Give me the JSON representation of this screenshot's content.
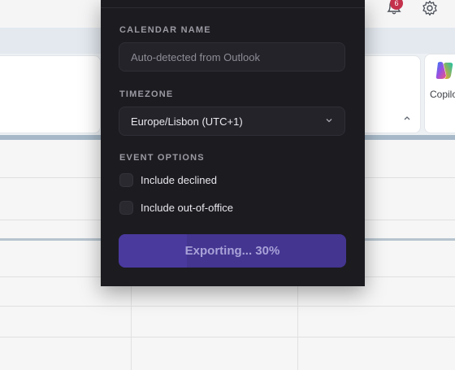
{
  "notifications": {
    "count": "6"
  },
  "ribbon": {
    "copilot_label": "Copilot"
  },
  "dialog": {
    "calendar_name": {
      "label": "CALENDAR NAME",
      "placeholder": "Auto-detected from Outlook"
    },
    "timezone": {
      "label": "TIMEZONE",
      "selected": "Europe/Lisbon (UTC+1)"
    },
    "event_options": {
      "label": "EVENT OPTIONS",
      "items": [
        {
          "label": "Include declined",
          "checked": false
        },
        {
          "label": "Include out-of-office",
          "checked": false
        }
      ]
    },
    "export": {
      "label": "Exporting... 30%",
      "progress": 0.3
    }
  },
  "colors": {
    "accent": "#433590",
    "panel_bg": "#1c1b20",
    "badge": "#c4314b"
  },
  "icons": [
    "bell-icon",
    "gear-icon",
    "chevron-down-icon",
    "chevron-up-icon",
    "copilot-icon"
  ]
}
